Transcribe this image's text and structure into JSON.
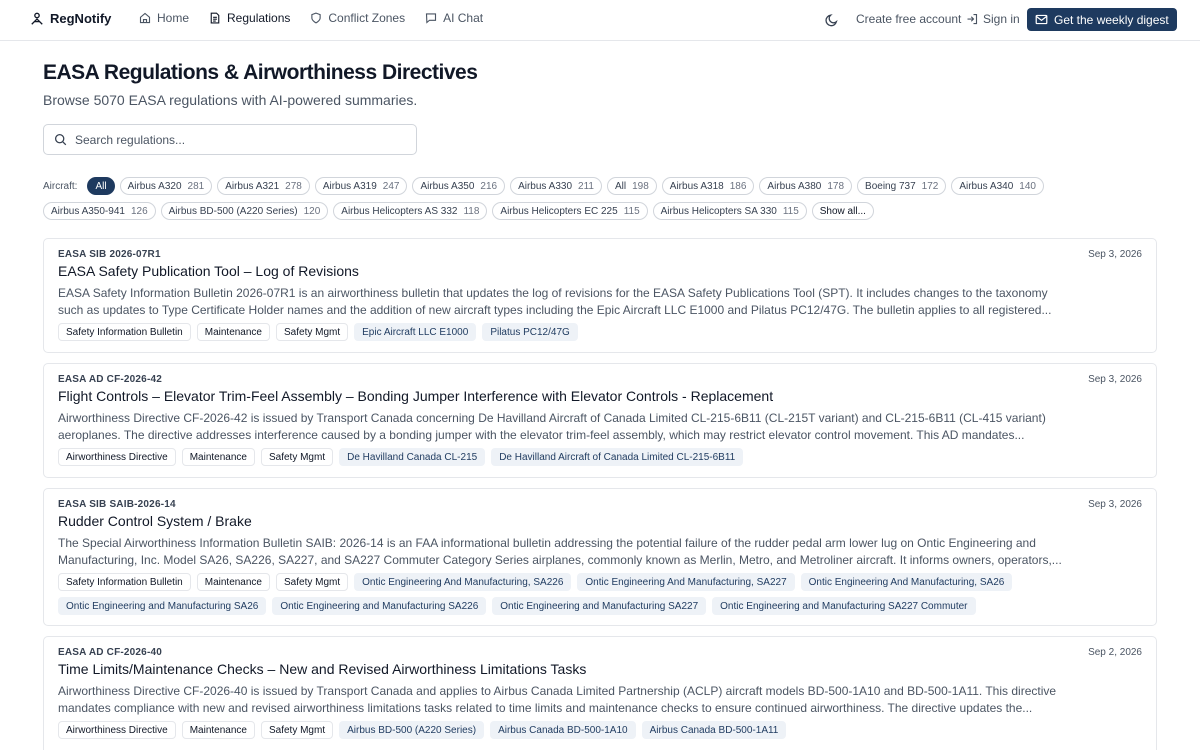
{
  "header": {
    "brand": "RegNotify",
    "nav": [
      "Home",
      "Regulations",
      "Conflict Zones",
      "AI Chat"
    ],
    "create_account": "Create free account",
    "sign_in": "Sign in",
    "digest_button": "Get the weekly digest"
  },
  "page": {
    "title": "EASA Regulations & Airworthiness Directives",
    "subtitle": "Browse 5070 EASA regulations with AI-powered summaries."
  },
  "search": {
    "placeholder": "Search regulations...",
    "value": ""
  },
  "filters": {
    "label": "Aircraft:",
    "row1": [
      {
        "label": "All",
        "count": ""
      },
      {
        "label": "Airbus A320",
        "count": "281"
      },
      {
        "label": "Airbus A321",
        "count": "278"
      },
      {
        "label": "Airbus A319",
        "count": "247"
      },
      {
        "label": "Airbus A350",
        "count": "216"
      },
      {
        "label": "Airbus A330",
        "count": "211"
      },
      {
        "label": "All",
        "count": "198"
      },
      {
        "label": "Airbus A318",
        "count": "186"
      },
      {
        "label": "Airbus A380",
        "count": "178"
      },
      {
        "label": "Boeing 737",
        "count": "172"
      },
      {
        "label": "Airbus A340",
        "count": "140"
      }
    ],
    "row2": [
      {
        "label": "Airbus A350-941",
        "count": "126"
      },
      {
        "label": "Airbus BD-500 (A220 Series)",
        "count": "120"
      },
      {
        "label": "Airbus Helicopters AS 332",
        "count": "118"
      },
      {
        "label": "Airbus Helicopters EC 225",
        "count": "115"
      },
      {
        "label": "Airbus Helicopters SA 330",
        "count": "115"
      }
    ],
    "show_all": "Show all..."
  },
  "cards": [
    {
      "ref": "EASA SIB 2026-07R1",
      "date": "Sep 3, 2026",
      "title": "EASA Safety Publication Tool – Log of Revisions",
      "summary_1": "EASA Safety Information Bulletin 2026-07R1 is an airworthiness bulletin that updates the log of revisions for the EASA Safety Publications Tool (SPT). It includes changes to the taxonomy",
      "summary_2": "such as updates to Type Certificate Holder names and the addition of new aircraft types including the Epic Aircraft LLC E1000 and Pilatus PC12/47G. The bulletin applies to all registered...",
      "tags": [
        "Safety Information Bulletin",
        "Maintenance",
        "Safety Mgmt"
      ],
      "models": [
        "Epic Aircraft LLC E1000",
        "Pilatus PC12/47G"
      ]
    },
    {
      "ref": "EASA AD CF-2026-42",
      "date": "Sep 3, 2026",
      "title": "Flight Controls – Elevator Trim-Feel Assembly – Bonding Jumper Interference with Elevator Controls - Replacement",
      "summary_1": "Airworthiness Directive CF-2026-42 is issued by Transport Canada concerning De Havilland Aircraft of Canada Limited CL-215-6B11 (CL-215T variant) and CL-215-6B11 (CL-415 variant)",
      "summary_2": "aeroplanes. The directive addresses interference caused by a bonding jumper with the elevator trim-feel assembly, which may restrict elevator control movement. This AD mandates...",
      "tags": [
        "Airworthiness Directive",
        "Maintenance",
        "Safety Mgmt"
      ],
      "models": [
        "De Havilland Canada CL-215",
        "De Havilland Aircraft of Canada Limited CL-215-6B11"
      ]
    },
    {
      "ref": "EASA SIB SAIB-2026-14",
      "date": "Sep 3, 2026",
      "title": "Rudder Control System / Brake",
      "summary_1": "The Special Airworthiness Information Bulletin SAIB: 2026-14 is an FAA informational bulletin addressing the potential failure of the rudder pedal arm lower lug on Ontic Engineering and",
      "summary_2": "Manufacturing, Inc. Model SA26, SA226, SA227, and SA227 Commuter Category Series airplanes, commonly known as Merlin, Metro, and Metroliner aircraft. It informs owners, operators,...",
      "tags": [
        "Safety Information Bulletin",
        "Maintenance",
        "Safety Mgmt"
      ],
      "models": [
        "Ontic Engineering And Manufacturing, SA226",
        "Ontic Engineering And Manufacturing, SA227",
        "Ontic Engineering And Manufacturing, SA26",
        "Ontic Engineering and Manufacturing SA26",
        "Ontic Engineering and Manufacturing SA226",
        "Ontic Engineering and Manufacturing SA227",
        "Ontic Engineering and Manufacturing SA227 Commuter"
      ]
    },
    {
      "ref": "EASA AD CF-2026-40",
      "date": "Sep 2, 2026",
      "title": "Time Limits/Maintenance Checks – New and Revised Airworthiness Limitations Tasks",
      "summary_1": "Airworthiness Directive CF-2026-40 is issued by Transport Canada and applies to Airbus Canada Limited Partnership (ACLP) aircraft models BD-500-1A10 and BD-500-1A11. This directive",
      "summary_2": "mandates compliance with new and revised airworthiness limitations tasks related to time limits and maintenance checks to ensure continued airworthiness. The directive updates the...",
      "tags": [
        "Airworthiness Directive",
        "Maintenance",
        "Safety Mgmt"
      ],
      "models": [
        "Airbus BD-500 (A220 Series)",
        "Airbus Canada BD-500-1A10",
        "Airbus Canada BD-500-1A11"
      ]
    }
  ],
  "colors": {
    "accent": "#1e3a5f",
    "model_tag_bg": "#eef2f7",
    "border": "#e5e7eb"
  }
}
